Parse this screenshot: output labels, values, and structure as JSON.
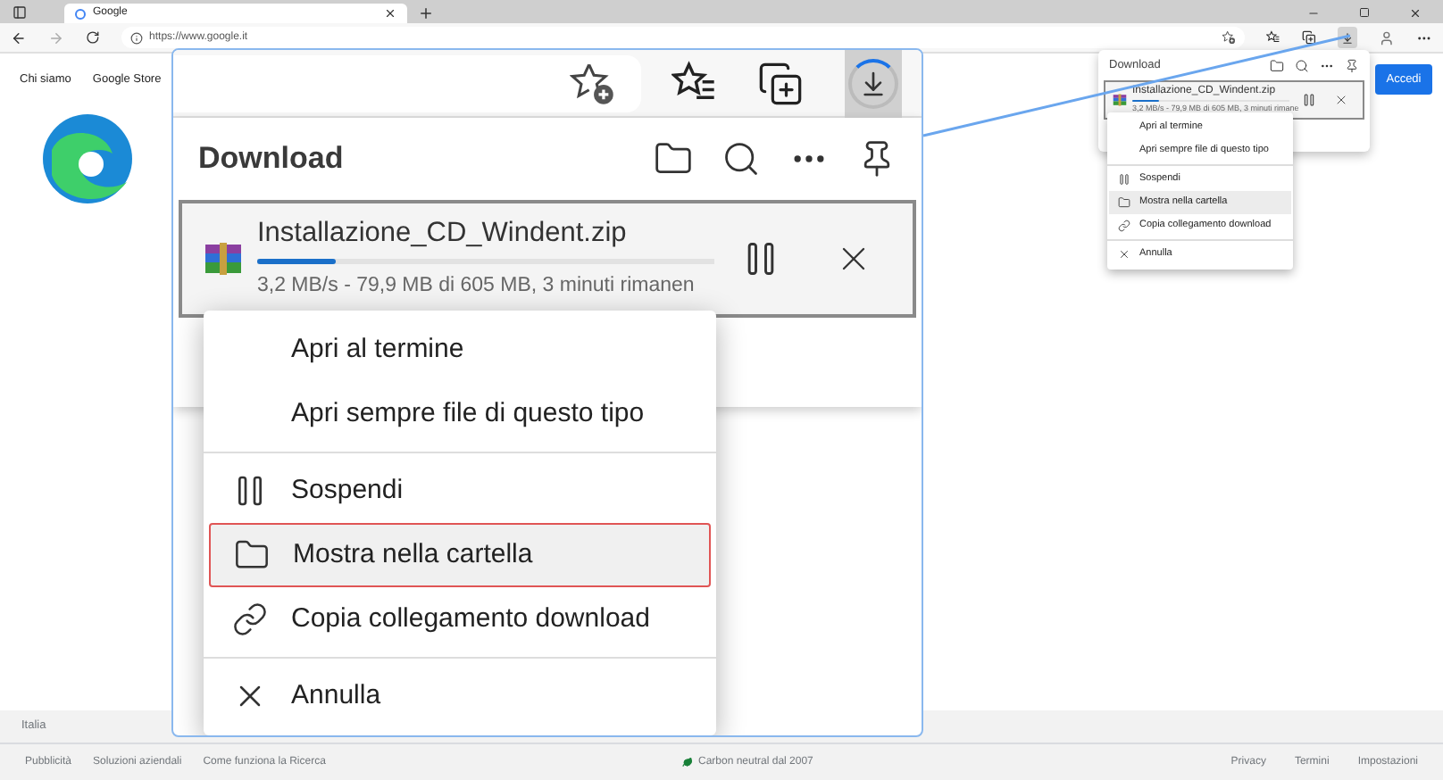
{
  "browser": {
    "tab_title": "Google",
    "address": "https://www.google.it"
  },
  "page": {
    "links": [
      "Chi siamo",
      "Google Store"
    ],
    "sign_in": "Accedi"
  },
  "panel": {
    "title": "Download",
    "file": "Installazione_CD_Windent.zip",
    "level": 0.17,
    "status": "3,2 MB/s - 79,9 MB di 605 MB, 3 minuti rimane",
    "menu": [
      {
        "kind": "text",
        "label": "Apri al termine",
        "selected": false
      },
      {
        "kind": "text",
        "label": "Apri sempre file di questo tipo",
        "selected": false
      },
      {
        "kind": "divider"
      },
      {
        "kind": "pause",
        "label": "Sospendi",
        "selected": false
      },
      {
        "kind": "folder",
        "label": "Mostra nella cartella",
        "selected": true
      },
      {
        "kind": "link",
        "label": "Copia collegamento download",
        "selected": false
      },
      {
        "kind": "divider"
      },
      {
        "kind": "cancel",
        "label": "Annulla",
        "selected": false
      }
    ]
  },
  "zoom_panel": {
    "title": "Download",
    "file": "Installazione_CD_Windent.zip",
    "level": 0.17,
    "status": "3,2 MB/s - 79,9 MB di 605 MB, 3 minuti rimanen",
    "menu": [
      {
        "kind": "text",
        "label": "Apri al termine",
        "selected": false
      },
      {
        "kind": "text",
        "label": "Apri sempre file di questo tipo",
        "selected": false
      },
      {
        "kind": "divider"
      },
      {
        "kind": "pause",
        "label": "Sospendi",
        "selected": false
      },
      {
        "kind": "folder",
        "label": "Mostra nella cartella",
        "selected": true
      },
      {
        "kind": "link",
        "label": "Copia collegamento download",
        "selected": false
      },
      {
        "kind": "divider"
      },
      {
        "kind": "cancel",
        "label": "Annulla",
        "selected": false
      }
    ]
  },
  "footer": {
    "country": "Italia",
    "left_links": [
      "Pubblicità",
      "Soluzioni aziendali",
      "Come funziona la Ricerca"
    ],
    "carbon": "Carbon neutral dal 2007",
    "right_links": [
      "Privacy",
      "Termini",
      "Impostazioni"
    ]
  }
}
